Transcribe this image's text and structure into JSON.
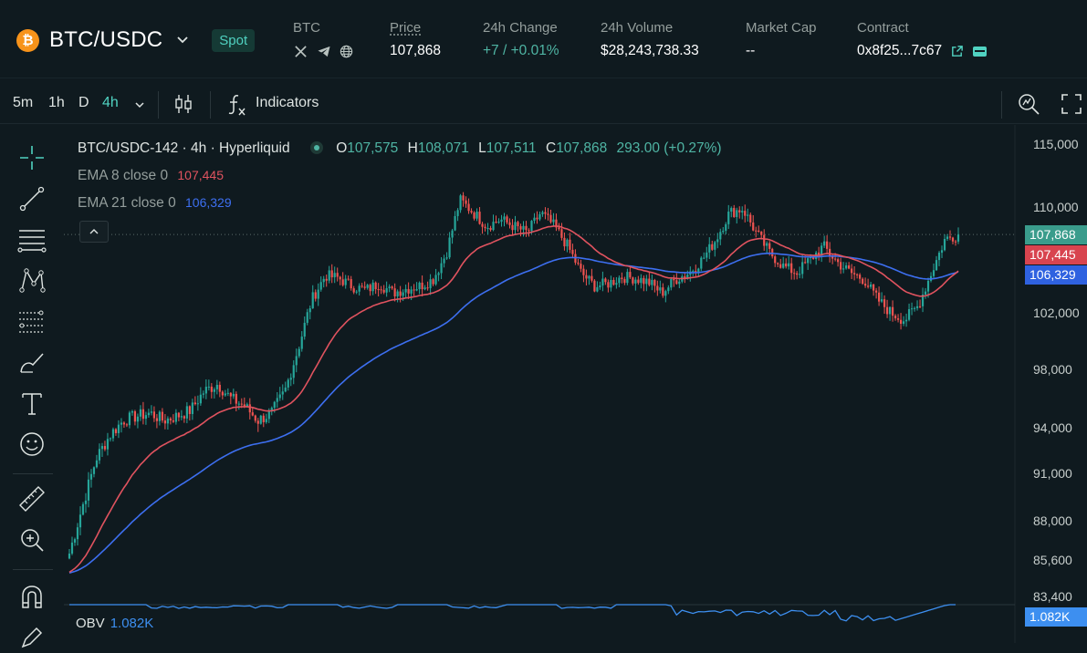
{
  "header": {
    "coin_symbol": "₿",
    "pair": "BTC/USDC",
    "market_type": "Spot",
    "base": {
      "label": "BTC",
      "links": [
        "x-icon",
        "telegram-icon",
        "globe-icon"
      ]
    },
    "price": {
      "label": "Price",
      "value": "107,868"
    },
    "change_24h": {
      "label": "24h Change",
      "value": "+7 / +0.01%"
    },
    "volume_24h": {
      "label": "24h Volume",
      "value": "$28,243,738.33"
    },
    "market_cap": {
      "label": "Market Cap",
      "value": "--"
    },
    "contract": {
      "label": "Contract",
      "value": "0x8f25...7c67"
    }
  },
  "toolbar": {
    "intervals": [
      "5m",
      "1h",
      "D",
      "4h"
    ],
    "active_interval": "4h",
    "indicators_label": "Indicators"
  },
  "legend": {
    "title": "BTC/USDC-142 · 4h · Hyperliquid",
    "o_label": "O",
    "o": "107,575",
    "h_label": "H",
    "h": "108,071",
    "l_label": "L",
    "l": "107,511",
    "c_label": "C",
    "c": "107,868",
    "change": "293.00 (+0.27%)",
    "ema8_label": "EMA 8 close 0",
    "ema8_value": "107,445",
    "ema21_label": "EMA 21 close 0",
    "ema21_value": "106,329"
  },
  "price_axis": {
    "labels": [
      "115,000",
      "110,000",
      "102,000",
      "98,000",
      "94,000",
      "91,000",
      "88,000",
      "85,600",
      "83,400"
    ],
    "tags": {
      "last": "107,868",
      "ema8": "107,445",
      "ema21": "106,329",
      "obv": "1.082K"
    }
  },
  "obv": {
    "label": "OBV",
    "value": "1.082K"
  },
  "colors": {
    "background": "#0f1a1f",
    "up": "#26a69a",
    "down": "#ef5350",
    "ema8": "#e0535f",
    "ema21": "#3d6ff0",
    "accent": "#50d2c1"
  },
  "chart_data": {
    "type": "candlestick",
    "interval": "4h",
    "close_anchors": [
      86000,
      89000,
      92000,
      93500,
      94500,
      94800,
      95000,
      94500,
      94800,
      95200,
      96500,
      97000,
      96000,
      95500,
      94500,
      95000,
      96500,
      99500,
      103000,
      104800,
      104600,
      104000,
      103700,
      104200,
      103500,
      103800,
      104000,
      104500,
      106500,
      110500,
      109500,
      108500,
      109000,
      108500,
      108000,
      109500,
      108500,
      107000,
      105000,
      104000,
      104200,
      104700,
      104600,
      104300,
      103500,
      104500,
      105000,
      106000,
      107500,
      109500,
      109800,
      108000,
      106500,
      105500,
      105000,
      106000,
      107000,
      105800,
      105000,
      104500,
      103000,
      102000,
      101500,
      102500,
      105000,
      107500,
      107868
    ],
    "ema8_last": 107445,
    "ema21_last": 106329,
    "y_range": [
      83400,
      115000
    ]
  }
}
